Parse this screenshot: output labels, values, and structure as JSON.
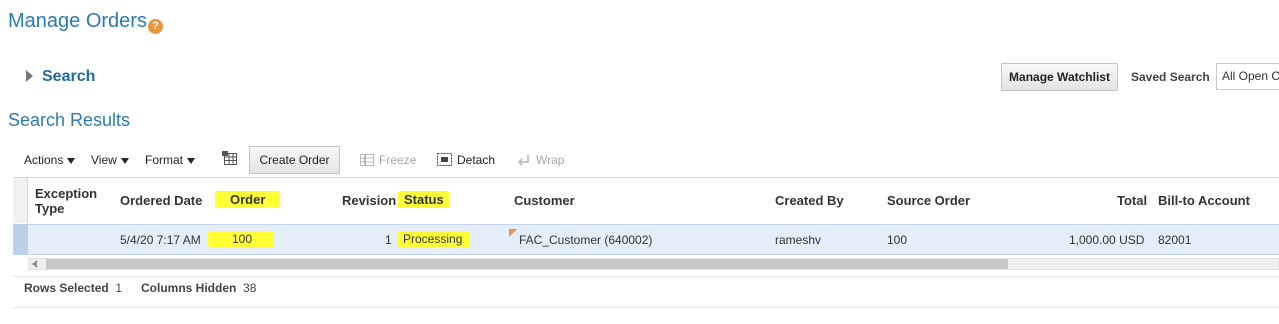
{
  "page": {
    "title": "Manage Orders",
    "help_glyph": "?"
  },
  "search": {
    "toggle_label": "Search",
    "manage_watchlist": "Manage Watchlist",
    "saved_search_label": "Saved Search",
    "saved_search_value": "All Open Orders"
  },
  "results": {
    "title": "Search Results",
    "toolbar": {
      "actions": "Actions",
      "view": "View",
      "format": "Format",
      "create_order": "Create Order",
      "freeze": "Freeze",
      "detach": "Detach",
      "wrap": "Wrap"
    },
    "columns": {
      "exception_type_1": "Exception",
      "exception_type_2": "Type",
      "ordered_date": "Ordered Date",
      "order": "Order",
      "revision": "Revision",
      "status": "Status",
      "customer": "Customer",
      "created_by": "Created By",
      "source_order": "Source Order",
      "total": "Total",
      "bill_to": "Bill-to Account"
    },
    "rows": [
      {
        "exception_type": "",
        "ordered_date": "5/4/20 7:17 AM",
        "order": "100",
        "revision": "1",
        "status": "Processing",
        "customer": "FAC_Customer (640002)",
        "created_by": "rameshv",
        "source_order": "100",
        "total": "1,000.00",
        "currency": "USD",
        "bill_to": "82001"
      }
    ],
    "footer": {
      "rows_selected_label": "Rows Selected",
      "rows_selected_value": "1",
      "columns_hidden_label": "Columns Hidden",
      "columns_hidden_value": "38"
    }
  },
  "colors": {
    "title_blue": "#2a7ab8",
    "highlight_yellow": "#ffff36",
    "selected_row": "#e3eef9",
    "help_orange": "#e8963a"
  }
}
